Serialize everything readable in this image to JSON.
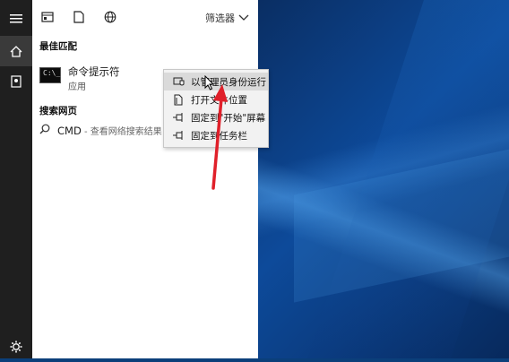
{
  "topbar": {
    "filter_label": "筛选器",
    "icons": [
      "apps-icon",
      "document-icon",
      "globe-icon",
      "chevron-down-icon"
    ]
  },
  "sidebar": {
    "icons": [
      "hamburger-menu-icon",
      "home-icon",
      "document-icon",
      "gear-icon"
    ]
  },
  "best_match": {
    "heading": "最佳匹配",
    "title": "命令提示符",
    "subtitle": "应用",
    "icon": "command-prompt-icon",
    "icon_text": "C:\\_"
  },
  "web_search": {
    "heading": "搜索网页",
    "query": "CMD",
    "suffix": " - 查看网络搜索结果"
  },
  "context_menu": {
    "items": [
      {
        "label": "以管理员身份运行",
        "icon": "shield-icon",
        "highlighted": true
      },
      {
        "label": "打开文件位置",
        "icon": "folder-icon",
        "highlighted": false
      },
      {
        "label": "固定到\"开始\"屏幕",
        "icon": "pin-icon",
        "highlighted": false
      },
      {
        "label": "固定到任务栏",
        "icon": "pin-icon",
        "highlighted": false
      }
    ]
  },
  "annotation": {
    "color": "#e0202a",
    "icon": "red-arrow"
  }
}
